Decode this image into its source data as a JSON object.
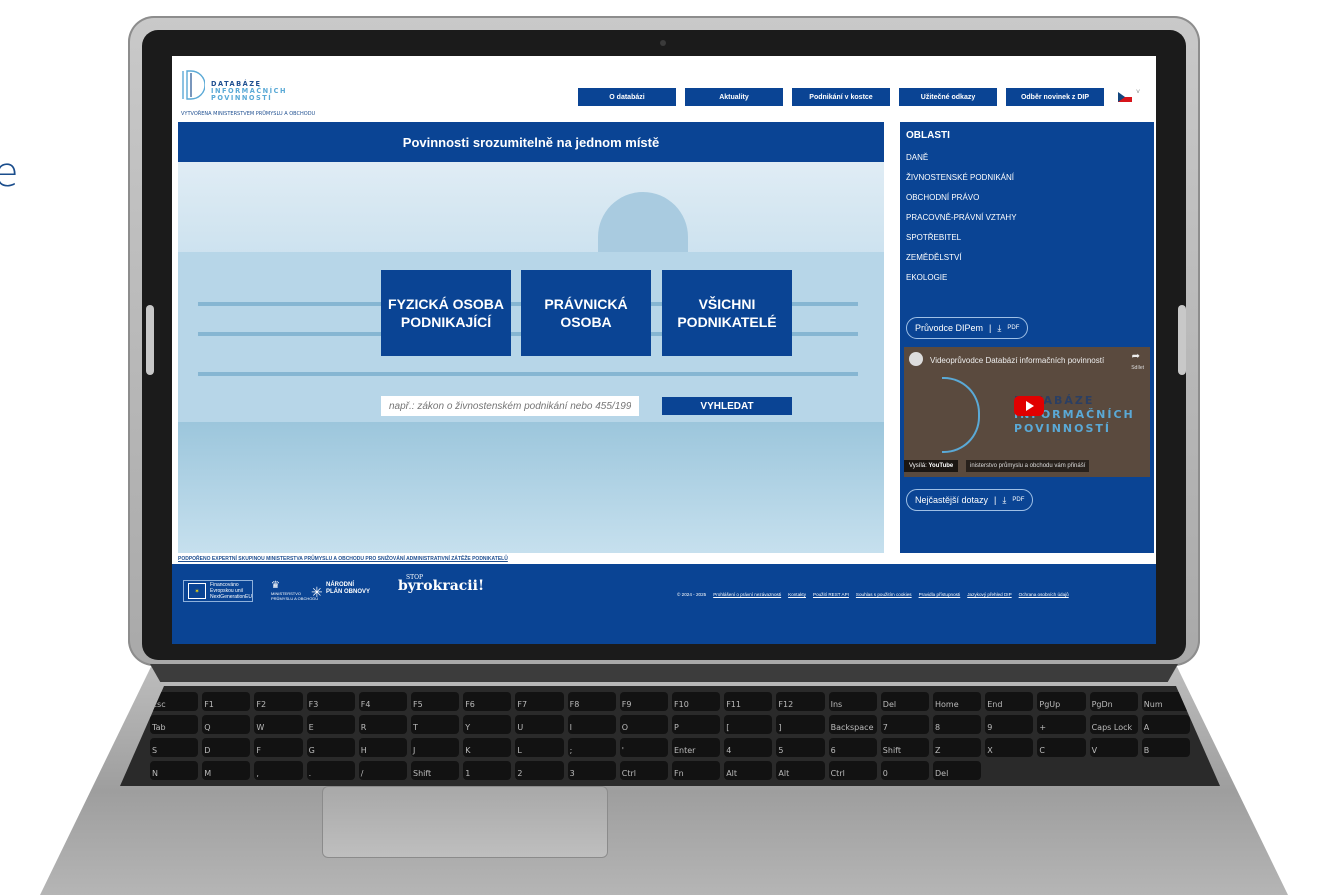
{
  "side_text": "e",
  "header": {
    "logo_line1": "DATABÁZE",
    "logo_line2": "INFORMAČNÍCH",
    "logo_line3": "POVINNOSTÍ",
    "logo_sub": "VYTVOŘENA MINISTERSTVEM PRŮMYSLU A OBCHODU",
    "nav": [
      "O databázi",
      "Aktuality",
      "Podnikání v kostce",
      "Užitečné odkazy",
      "Odběr novinek z DIP"
    ],
    "flag_chevron": "˅"
  },
  "hero": {
    "title": "Povinnosti srozumitelně na jednom místě",
    "tiles": [
      "FYZICKÁ OSOBA PODNIKAJÍCÍ",
      "PRÁVNICKÁ OSOBA",
      "VŠICHNI PODNIKATELÉ"
    ],
    "search_placeholder": "např.: zákon o živnostenském podnikání nebo 455/1991",
    "search_button": "VYHLEDAT"
  },
  "sidebar": {
    "heading": "OBLASTI",
    "categories": [
      "DANĚ",
      "ŽIVNOSTENSKÉ PODNIKÁNÍ",
      "OBCHODNÍ PRÁVO",
      "PRACOVNĚ-PRÁVNÍ VZTAHY",
      "SPOTŘEBITEL",
      "ZEMĚDĚLSTVÍ",
      "EKOLOGIE"
    ],
    "guide_pill": "Průvodce DIPem",
    "faq_pill": "Nejčastější dotazy",
    "pdf_label": "PDF",
    "video": {
      "title": "Videoprůvodce Databází informačních povinností",
      "share": "Sdílet",
      "line1": "DATABÁZE",
      "line2": "INFORMAČNÍCH",
      "line3": "POVINNOSTÍ",
      "vysila": "Vysílá:",
      "youtube": "YouTube",
      "footer_text": "inisterstvo průmyslu a obchodu vám přináší"
    }
  },
  "support_text": "PODPOŘENO EXPERTNÍ SKUPINOU MINISTERSTVA PRŮMYSLU A OBCHODU PRO SNIŽOVÁNÍ ADMINISTRATIVNÍ ZÁTĚŽE PODNIKATELŮ",
  "footer": {
    "eu_line1": "Financováno",
    "eu_line2": "Evropskou unií",
    "eu_line3": "NextGenerationEU",
    "mpo_line1": "MINISTERSTVO",
    "mpo_line2": "PRŮMYSLU A OBCHODU",
    "npo_line1": "NÁRODNÍ",
    "npo_line2": "PLÁN OBNOVY",
    "stop_top": "STOP",
    "stop_main": "byrokracii!",
    "copyright": "© 2024 - 2025",
    "links": [
      "Prohlášení o právní nezávaznosti",
      "Kontakty",
      "Použití REST API",
      "Souhlas s použitím cookies",
      "Pravidla přístupnosti",
      "Jazykový přehled DIP",
      "Ochrana osobních údajů"
    ]
  },
  "keyboard": {
    "keys": [
      "Esc",
      "F1",
      "F2",
      "F3",
      "F4",
      "F5",
      "F6",
      "F7",
      "F8",
      "F9",
      "F10",
      "F11",
      "F12",
      "Ins",
      "Del",
      "Home",
      "End",
      "PgUp",
      "PgDn",
      "Num",
      "Tab",
      "Q",
      "W",
      "E",
      "R",
      "T",
      "Y",
      "U",
      "I",
      "O",
      "P",
      "[",
      "]",
      "Backspace",
      "7",
      "8",
      "9",
      "+",
      "Caps Lock",
      "A",
      "S",
      "D",
      "F",
      "G",
      "H",
      "J",
      "K",
      "L",
      ";",
      "'",
      "Enter",
      "4",
      "5",
      "6",
      "Shift",
      "Z",
      "X",
      "C",
      "V",
      "B",
      "N",
      "M",
      ",",
      ".",
      "/",
      "Shift",
      "1",
      "2",
      "3",
      "Ctrl",
      "Fn",
      "Alt",
      "Alt",
      "Ctrl",
      "0",
      "Del"
    ]
  },
  "colors": {
    "brand_blue": "#0a4494",
    "accent_light_blue": "#5aa9d6"
  }
}
